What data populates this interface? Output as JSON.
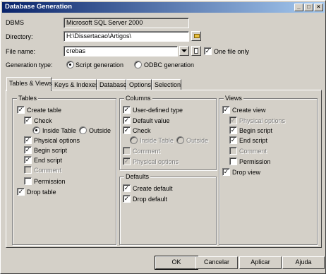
{
  "window": {
    "title": "Database Generation"
  },
  "form": {
    "dbms_label": "DBMS",
    "dbms_value": "Microsoft SQL Server 2000",
    "directory_label": "Directory:",
    "directory_value": "H:\\Dissertacao\\Artigos\\",
    "filename_label": "File name:",
    "filename_value": "crebas",
    "one_file_label": "One file only",
    "one_file_checked": true,
    "gentype_label": "Generation type:",
    "gentype_options": [
      "Script generation",
      "ODBC generation"
    ],
    "gentype_selected": "Script generation"
  },
  "tabs": [
    "Tables & Views",
    "Keys & Indexes",
    "Database",
    "Options",
    "Selection"
  ],
  "active_tab": "Tables & Views",
  "tables": {
    "title": "Tables",
    "create_table": "Create table",
    "check": "Check",
    "inside_table": "Inside Table",
    "outside": "Outside",
    "physical_options": "Physical options",
    "begin_script": "Begin script",
    "end_script": "End script",
    "comment": "Comment",
    "permission": "Permission",
    "drop_table": "Drop table"
  },
  "columns": {
    "title": "Columns",
    "user_defined_type": "User-defined type",
    "default_value": "Default value",
    "check": "Check",
    "inside_table": "Inside Table",
    "outside": "Outside",
    "comment": "Comment",
    "physical_options": "Physical options"
  },
  "defaults": {
    "title": "Defaults",
    "create_default": "Create default",
    "drop_default": "Drop default"
  },
  "views": {
    "title": "Views",
    "create_view": "Create view",
    "physical_options": "Physical options",
    "begin_script": "Begin script",
    "end_script": "End script",
    "comment": "Comment",
    "permission": "Permission",
    "drop_view": "Drop view"
  },
  "buttons": {
    "ok": "OK",
    "cancel": "Cancelar",
    "apply": "Aplicar",
    "help": "Ajuda"
  },
  "check_mark": "✓"
}
